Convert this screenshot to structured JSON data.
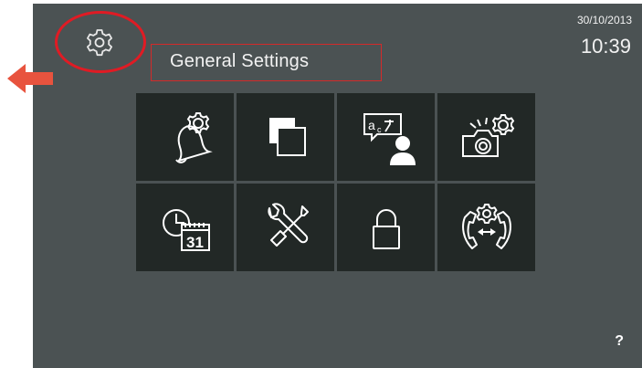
{
  "header": {
    "title": "General Settings",
    "date": "30/10/2013",
    "time": "10:39"
  },
  "settings_tiles": [
    {
      "icon": "bell-gear-icon"
    },
    {
      "icon": "windows-icon"
    },
    {
      "icon": "language-user-icon"
    },
    {
      "icon": "camera-gear-icon"
    },
    {
      "icon": "clock-calendar-icon",
      "calendar_day": "31"
    },
    {
      "icon": "tools-icon"
    },
    {
      "icon": "lock-icon"
    },
    {
      "icon": "call-transfer-gear-icon"
    }
  ],
  "footer": {
    "help_label": "?"
  },
  "colors": {
    "screen_bg": "#4b5253",
    "tile_bg": "#222826",
    "highlight": "#e01b24",
    "arrow": "#e8533e"
  }
}
